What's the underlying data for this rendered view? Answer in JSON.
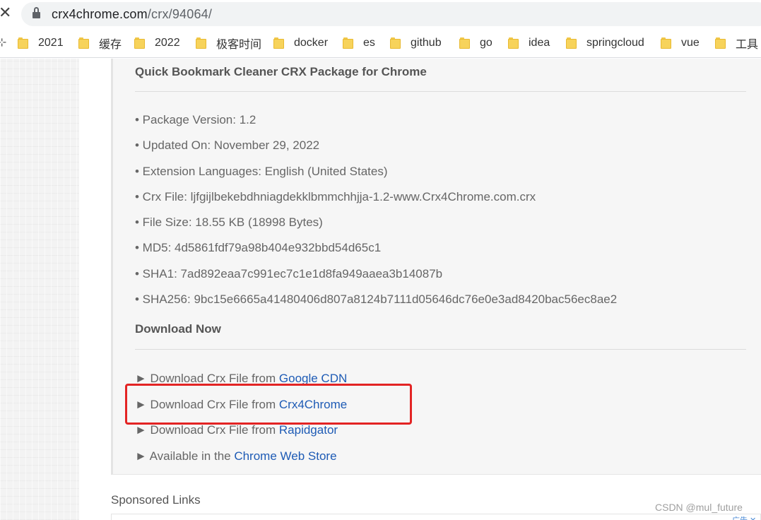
{
  "browser": {
    "close_glyph": "✕",
    "url_host": "crx4chrome.com",
    "url_path": "/crx/94064/",
    "lock_icon": "lock-icon"
  },
  "bookmarks": [
    {
      "label": "2021"
    },
    {
      "label": "缓存"
    },
    {
      "label": "2022"
    },
    {
      "label": "极客时间"
    },
    {
      "label": "docker"
    },
    {
      "label": "es"
    },
    {
      "label": "github"
    },
    {
      "label": "go"
    },
    {
      "label": "idea"
    },
    {
      "label": "springcloud"
    },
    {
      "label": "vue"
    },
    {
      "label": "工具"
    }
  ],
  "main": {
    "package_title": "Quick Bookmark Cleaner CRX Package for Chrome",
    "info": [
      "• Package Version: 1.2",
      "• Updated On: November 29, 2022",
      "• Extension Languages: English (United States)",
      "• Crx File: ljfgijlbekebdhniagdekklbmmchhjja-1.2-www.Crx4Chrome.com.crx",
      "• File Size: 18.55 KB (18998 Bytes)",
      "• MD5: 4d5861fdf79a98b404e932bbd54d65c1",
      "• SHA1: 7ad892eaa7c991ec7c1e1d8fa949aaea3b14087b",
      "• SHA256: 9bc15e6665a41480406d807a8124b7111d05646dc76e0e3ad8420bac56ec8ae2"
    ],
    "download_title": "Download Now",
    "downloads": [
      {
        "prefix": "► Download Crx File from ",
        "link": "Google CDN"
      },
      {
        "prefix": "► Download Crx File from ",
        "link": "Crx4Chrome"
      },
      {
        "prefix": "► Download Crx File from ",
        "link": "Rapidgator"
      },
      {
        "prefix": "► Available in the ",
        "link": "Chrome Web Store"
      }
    ],
    "sponsored_title": "Sponsored Links",
    "ad_tag": "广告 ✕"
  },
  "watermark": "CSDN @mul_future",
  "colors": {
    "link": "#1e5bb5",
    "highlight": "#e32424",
    "folder": "#f7d35b"
  }
}
